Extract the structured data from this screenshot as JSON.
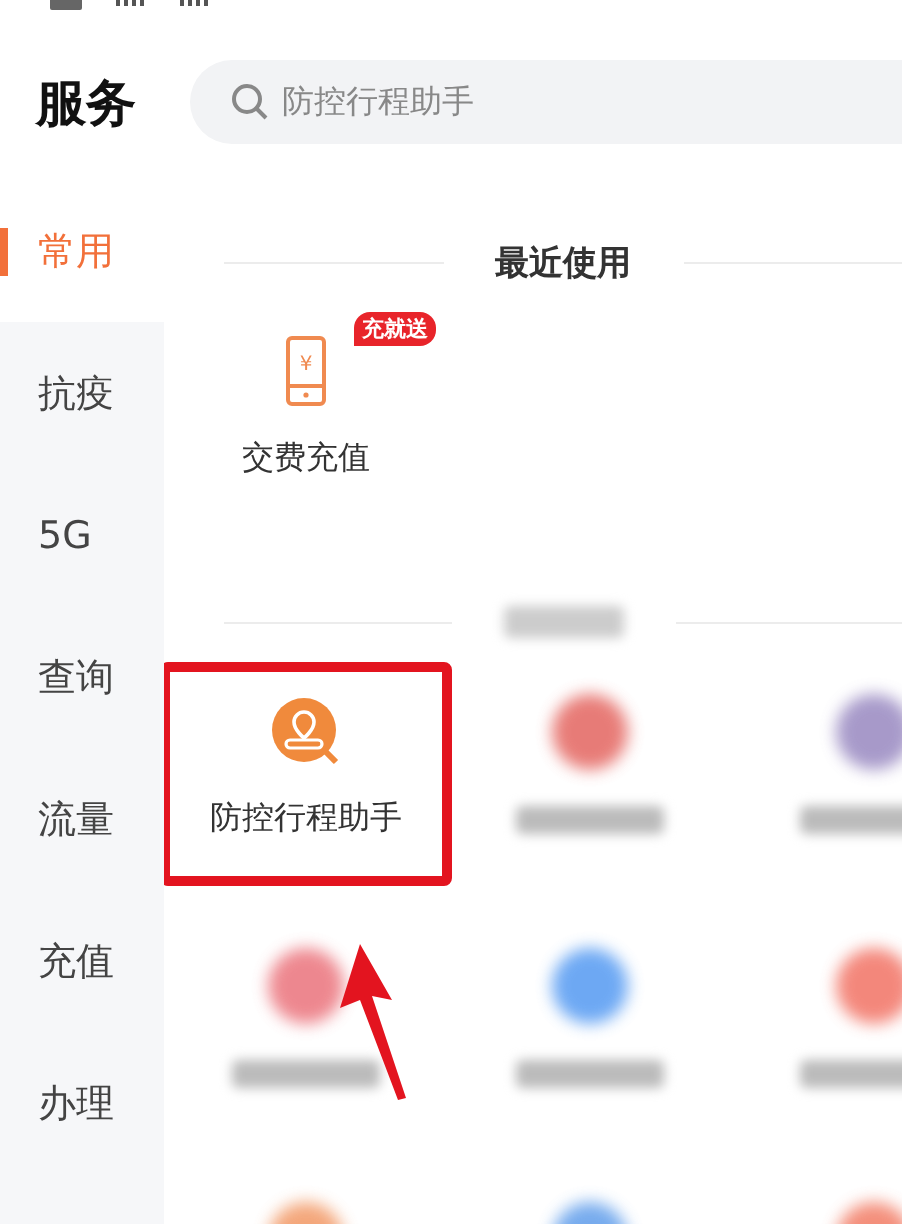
{
  "header": {
    "title": "服务",
    "search": {
      "placeholder": "防控行程助手"
    }
  },
  "sidebar": {
    "items": [
      {
        "label": "常用",
        "selected": true
      },
      {
        "label": "抗疫",
        "selected": false
      },
      {
        "label": "5G",
        "selected": false
      },
      {
        "label": "查询",
        "selected": false
      },
      {
        "label": "流量",
        "selected": false
      },
      {
        "label": "充值",
        "selected": false
      },
      {
        "label": "办理",
        "selected": false
      }
    ]
  },
  "recent": {
    "title": "最近使用",
    "items": [
      {
        "label": "交费充值",
        "badge": "充就送",
        "icon_glyph": "¥"
      }
    ]
  },
  "featured": {
    "items": [
      {
        "kind": "service",
        "label": "防控行程助手",
        "highlighted": true
      },
      {
        "kind": "blurred",
        "highlighted": false
      },
      {
        "kind": "blurred",
        "highlighted": false
      },
      {
        "kind": "blurred",
        "highlighted": false
      },
      {
        "kind": "blurred",
        "highlighted": false
      },
      {
        "kind": "blurred",
        "highlighted": false
      },
      {
        "kind": "blurred",
        "highlighted": false
      },
      {
        "kind": "blurred",
        "highlighted": false
      },
      {
        "kind": "blurred",
        "highlighted": false
      }
    ]
  }
}
